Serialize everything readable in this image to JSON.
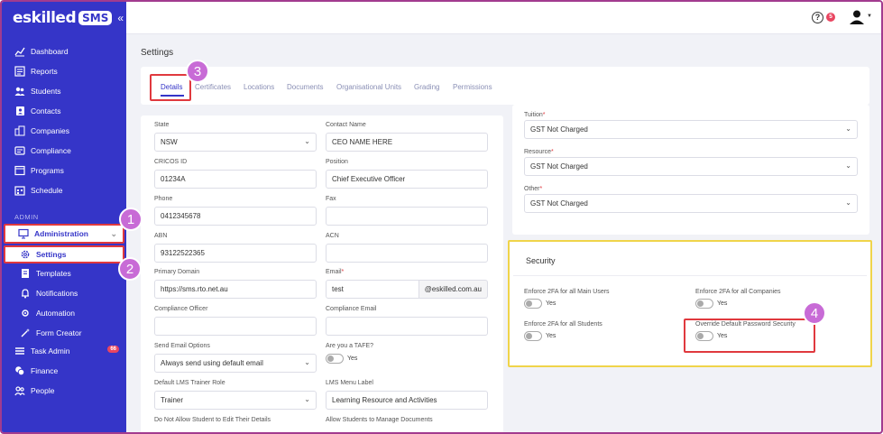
{
  "sidebar": {
    "logo_text": "eskilled",
    "logo_badge": "SMS",
    "collapse_glyph": "«",
    "items": [
      {
        "label": "Dashboard",
        "icon": "chart-line-icon"
      },
      {
        "label": "Reports",
        "icon": "report-icon"
      },
      {
        "label": "Students",
        "icon": "users-icon"
      },
      {
        "label": "Contacts",
        "icon": "contacts-icon"
      },
      {
        "label": "Companies",
        "icon": "building-icon"
      },
      {
        "label": "Compliance",
        "icon": "compliance-icon"
      },
      {
        "label": "Programs",
        "icon": "programs-icon"
      },
      {
        "label": "Schedule",
        "icon": "calendar-icon"
      }
    ],
    "section_label": "ADMIN",
    "admin": {
      "label": "Administration",
      "icon": "monitor-icon"
    },
    "admin_sub": [
      {
        "label": "Settings",
        "icon": "gear-icon"
      },
      {
        "label": "Templates",
        "icon": "template-icon"
      },
      {
        "label": "Notifications",
        "icon": "bell-icon"
      },
      {
        "label": "Automation",
        "icon": "automation-icon"
      },
      {
        "label": "Form Creator",
        "icon": "wand-icon"
      }
    ],
    "bottom": [
      {
        "label": "Task Admin",
        "icon": "list-icon",
        "badge": "66"
      },
      {
        "label": "Finance",
        "icon": "coins-icon"
      },
      {
        "label": "People",
        "icon": "people-icon"
      }
    ]
  },
  "topbar": {
    "help_glyph": "?",
    "notif_count": "5"
  },
  "page_title": "Settings",
  "tabs": [
    "Details",
    "Certificates",
    "Locations",
    "Documents",
    "Organisational Units",
    "Grading",
    "Permissions"
  ],
  "form": {
    "state": {
      "label": "State",
      "value": "NSW"
    },
    "contact_name": {
      "label": "Contact Name",
      "value": "CEO NAME HERE"
    },
    "cricos": {
      "label": "CRICOS ID",
      "value": "01234A"
    },
    "position": {
      "label": "Position",
      "value": "Chief Executive Officer"
    },
    "phone": {
      "label": "Phone",
      "value": "0412345678"
    },
    "fax": {
      "label": "Fax",
      "value": ""
    },
    "abn": {
      "label": "ABN",
      "value": "93122522365"
    },
    "acn": {
      "label": "ACN",
      "value": ""
    },
    "primary_domain": {
      "label": "Primary Domain",
      "value": "https://sms.rto.net.au"
    },
    "email": {
      "label": "Email",
      "required": "*",
      "value": "test",
      "suffix": "@eskilled.com.au"
    },
    "compliance_officer": {
      "label": "Compliance Officer",
      "value": ""
    },
    "compliance_email": {
      "label": "Compliance Email",
      "value": ""
    },
    "send_email": {
      "label": "Send Email Options",
      "value": "Always send using default email"
    },
    "tafe": {
      "label": "Are you a TAFE?",
      "toggle_label": "Yes"
    },
    "trainer_role": {
      "label": "Default LMS Trainer Role",
      "value": "Trainer"
    },
    "lms_menu": {
      "label": "LMS Menu Label",
      "value": "Learning Resource and Activities"
    },
    "no_edit": {
      "label": "Do Not Allow Student to Edit Their Details"
    },
    "manage_docs": {
      "label": "Allow Students to Manage Documents"
    }
  },
  "right_form": {
    "tuition": {
      "label": "Tuition",
      "required": "*",
      "value": "GST Not Charged"
    },
    "resource": {
      "label": "Resource",
      "required": "*",
      "value": "GST Not Charged"
    },
    "other": {
      "label": "Other",
      "required": "*",
      "value": "GST Not Charged"
    }
  },
  "security": {
    "title": "Security",
    "items": [
      {
        "label": "Enforce 2FA for all Main Users",
        "toggle_label": "Yes"
      },
      {
        "label": "Enforce 2FA for all Companies",
        "toggle_label": "Yes"
      },
      {
        "label": "Enforce 2FA for all Students",
        "toggle_label": "Yes"
      },
      {
        "label": "Override Default Password Security",
        "toggle_label": "Yes"
      }
    ]
  },
  "steps": [
    "1",
    "2",
    "3",
    "4"
  ],
  "colors": {
    "sidebar": "#3535c8",
    "accent": "#3535c8",
    "highlight_red": "#e0393e",
    "highlight_yellow": "#f0d44a",
    "step": "#c86bd6"
  }
}
